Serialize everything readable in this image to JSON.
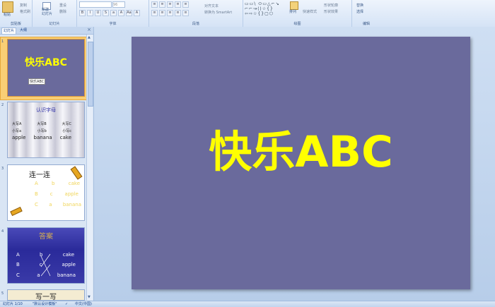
{
  "ribbon": {
    "clipboard": {
      "group": "剪贴板",
      "paste": "粘贴",
      "copy": "复制",
      "format_painter": "格式刷"
    },
    "slides": {
      "group": "幻灯片",
      "new_slide": "新建\n幻灯片",
      "reset": "重设",
      "delete": "删除"
    },
    "font": {
      "group": "字体",
      "font_size": "96",
      "buttons": [
        "B",
        "I",
        "U",
        "S",
        "a",
        "A",
        "Aa",
        "A"
      ]
    },
    "paragraph": {
      "group": "段落",
      "align_text": "对齐文本",
      "convert_smartart": "转换为 SmartArt"
    },
    "drawing": {
      "group": "绘图",
      "shapes": "▭▭\\ ⬭▭△⌐↘\n⌐⌐↝⟨⟩☆{}\n⇦⇨☆{}▢⬡",
      "arrange": "排列",
      "quick_styles": "快速样式",
      "shape_fill": "形状轮廓",
      "shape_effects": "形状效果"
    },
    "editing": {
      "group": "编辑",
      "replace": "替换",
      "select": "选择"
    }
  },
  "panel": {
    "tab_slides": "幻灯片",
    "tab_outline": "大纲",
    "close": "×"
  },
  "thumbnails": {
    "s1": {
      "num": "1",
      "title": "快乐ABC",
      "subtitle": "快乐ABC"
    },
    "s2": {
      "num": "2",
      "title": "认识字母",
      "row1": [
        "大写A",
        "大写B",
        "大写C"
      ],
      "row2": [
        "小写a",
        "小写b",
        "小写c"
      ],
      "row3": [
        "apple",
        "banana",
        "cake"
      ]
    },
    "s3": {
      "num": "3",
      "title": "连一连",
      "row1": [
        "A",
        "b",
        "cake"
      ],
      "row2": [
        "B",
        "c",
        "apple"
      ],
      "row3": [
        "C",
        "a",
        "banana"
      ]
    },
    "s4": {
      "num": "4",
      "title": "答案",
      "row1": [
        "A",
        "b",
        "cake"
      ],
      "row2": [
        "B",
        "c",
        "apple"
      ],
      "row3": [
        "C",
        "a",
        "banana"
      ]
    },
    "s5": {
      "num": "5",
      "title": "写一写"
    }
  },
  "main_slide": {
    "title": "快乐ABC"
  },
  "status": {
    "slide_count": "幻灯片 1/10",
    "theme": "\"默认设计模板\"",
    "language": "中文(中国)"
  },
  "colors": {
    "slide_bg": "#6a6a9c",
    "title_yellow": "#ffff00",
    "selection": "#f9cf75"
  }
}
